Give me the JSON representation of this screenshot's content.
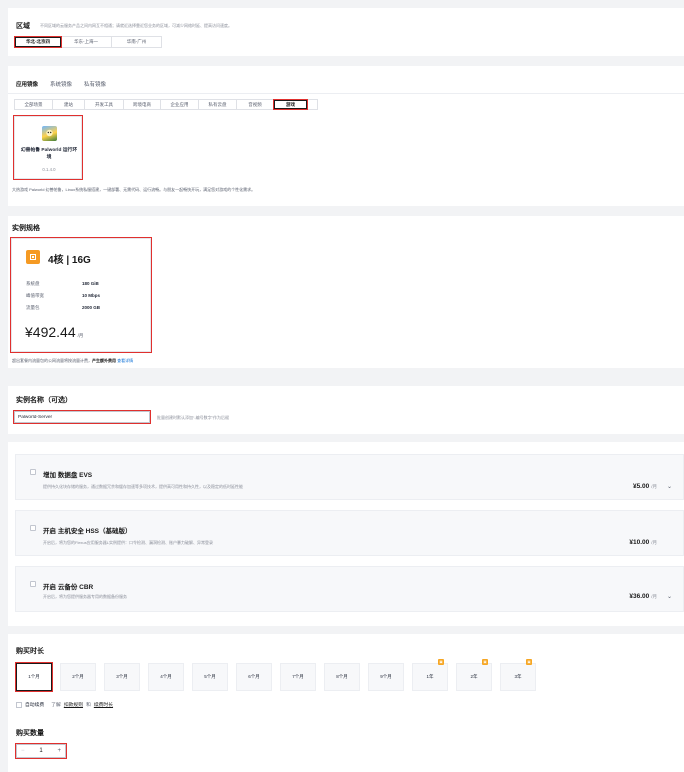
{
  "region": {
    "title": "区域",
    "hint": "不同区域的云服务产品之间内网互不相通；请就近选择靠近您业务的区域，可减少网络时延、提高访问速度。",
    "options": [
      "华北-北京四",
      "华东-上海一",
      "华南-广州"
    ],
    "selected": 0
  },
  "image": {
    "tabs": [
      "应用镜像",
      "系统镜像",
      "私有镜像"
    ],
    "active_tab": 0,
    "categories": [
      "全部场景",
      "建站",
      "开发工具",
      "跨境电商",
      "企业应用",
      "私有云盘",
      "音视频",
      "游戏"
    ],
    "active_category": 7,
    "card": {
      "name": "幻兽帕鲁 Palworld 运行环境",
      "version": "0.1.4.0"
    },
    "description": "大热游戏 Palworld 幻兽帕鲁，Linux系统私服搭建，一键部署、无需代码、运行流畅。与朋友一起畅快开玩，满足您对游戏的个性化需求。"
  },
  "instance": {
    "title": "实例规格",
    "spec": "4核 | 16G",
    "rows": [
      {
        "label": "系统盘",
        "value": "180 GiB"
      },
      {
        "label": "峰值带宽",
        "value": "10 Mbps"
      },
      {
        "label": "流量包",
        "value": "2000 GB"
      }
    ],
    "price": "¥492.44",
    "unit": "/月",
    "note_prefix": "超出套餐内流量包的公网流量将按流量计费，",
    "note_bold": "产生额外费用",
    "note_link": "查看详情"
  },
  "name": {
    "title": "实例名称（可选）",
    "value": "Palworld-Server",
    "hint": "批量创建时默认添加“-编号数字”作为后缀"
  },
  "addons": [
    {
      "prefix": "增加",
      "title": "数据盘 EVS",
      "desc": "提供持久化块存储的服务，通过数据冗余和缓存加速等多项技术，提供高可用性和持久性，以及稳定的低时延性能",
      "price": "¥5.00",
      "unit": "/月",
      "expand": true
    },
    {
      "prefix": "开启",
      "title": "主机安全 HSS（基础版）",
      "desc": "开启后，将为您的Flexus应用服务器L实例提供：口令检测、漏洞检测、账户暴力破解、异常登录",
      "price": "¥10.00",
      "unit": "/月",
      "expand": false
    },
    {
      "prefix": "开启",
      "title": "云备份 CBR",
      "desc": "开启后，将为您提供服务器专用的数据备份服务",
      "price": "¥36.00",
      "unit": "/月",
      "expand": true
    }
  ],
  "duration": {
    "title": "购买时长",
    "options": [
      "1个月",
      "2个月",
      "3个月",
      "4个月",
      "5个月",
      "6个月",
      "7个月",
      "8个月",
      "9个月",
      "1年",
      "2年",
      "3年"
    ],
    "selected": 0,
    "gift_badges": [
      9,
      10,
      11
    ],
    "auto_renew_label": "自动续费",
    "auto_renew_learn": "了解",
    "auto_renew_rule": "扣款规则",
    "auto_renew_and": "和",
    "auto_renew_period": "续费时长"
  },
  "quantity": {
    "title": "购买数量",
    "value": "1",
    "minus": "−",
    "plus": "+"
  }
}
